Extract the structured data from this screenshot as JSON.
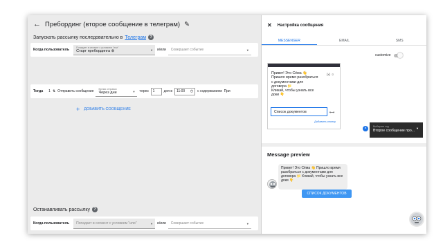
{
  "header": {
    "title": "Пребординг (второе сообщение в телеграм)"
  },
  "sequence_line": {
    "prefix": "Запускать рассылку последовательно в",
    "link": "Телеграм"
  },
  "user_row": {
    "label": "Когда пользователь",
    "segment_small": "Попадает в сегмент с условием \"или\"",
    "segment_value": "Старт пребординга",
    "andor": "и/или",
    "event_placeholder": "Совершает событие"
  },
  "then_row": {
    "label": "Тогда",
    "index": "1",
    "action": "Отправить сообщение",
    "send_small": "Время отправки",
    "send_value": "Через дни",
    "through": "через",
    "days_value": "1",
    "days_label": "дня в",
    "time_value": "11:00",
    "content_label": "с содержанием",
    "content_short": "При"
  },
  "add_message": "ДОБАВИТЬ СООБЩЕНИЕ",
  "stop_line": {
    "label": "Останавливать рассылку"
  },
  "stop_row": {
    "label": "Когда пользователь",
    "segment_placeholder": "Попадает в сегмент с условием \"или\"",
    "andor": "и/или",
    "event_placeholder": "Совершает событие"
  },
  "panel": {
    "title": "Настройка сообщения",
    "tabs": [
      "MESSENGER",
      "EMAIL",
      "SMS"
    ],
    "customize": "customize",
    "editor": {
      "text_lines": [
        "Привет! Это Сёма 👋",
        "Пришло время разобраться",
        "с документами для",
        "договора 📁",
        "Кликай, чтобы узнать все",
        "доки 👇"
      ],
      "counter": "{x}",
      "button_text": "Список документов",
      "add_button": "Добавить кнопку"
    },
    "next_step": {
      "small": "Выберите ход",
      "value": "Второе сообщение про..."
    }
  },
  "preview": {
    "title": "Message preview",
    "bubble_text": "Привет! Это Сёма 👋 Пришло время разобраться с документами для договора 📁 Кликай, чтобы узнать все доки 👇",
    "cta": "СПИСОК ДОКУМЕНТОВ"
  },
  "colors": {
    "accent": "#1a73e8",
    "cta": "#3f97f3",
    "dark": "#2b2b2b"
  },
  "icons": [
    "back-arrow-icon",
    "pencil-icon",
    "help-icon",
    "close-icon",
    "emoji-icon",
    "clock-icon",
    "bot-avatar-icon"
  ]
}
